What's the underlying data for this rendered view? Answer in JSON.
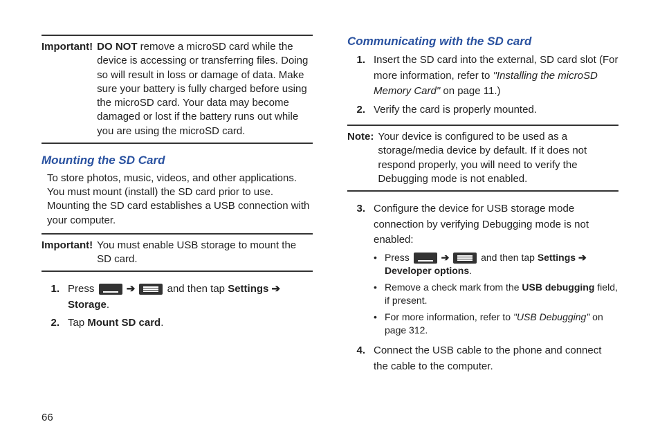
{
  "page_number": "66",
  "left": {
    "important1_label": "Important!",
    "important1_donot": "DO NOT",
    "important1_text": " remove a microSD card while the device is accessing or transferring files. Doing so will result in loss or damage of data. Make sure your battery is fully charged before using the microSD card. Your data may become damaged or lost if the battery runs out while you are using the microSD card.",
    "heading1": "Mounting the SD Card",
    "para1": "To store photos, music, videos, and other applications. You must mount (install) the SD card prior to use. Mounting the SD card establishes a USB connection with your computer.",
    "important2_label": "Important!",
    "important2_text": "You must enable USB storage to mount the SD card.",
    "step1_pre": "Press ",
    "step1_mid": " and then tap ",
    "step1_bold1": "Settings ",
    "step1_arrow": "➔",
    "step1_bold2": " Storage",
    "step2_pre": "Tap ",
    "step2_bold": "Mount SD card",
    "period": "."
  },
  "right": {
    "heading2": "Communicating with the SD card",
    "r1_text": "Insert the SD card into the external, SD card slot (For more information, refer to ",
    "r1_italic": "\"Installing the microSD Memory Card\"",
    "r1_after": "  on page 11.)",
    "r2_text": "Verify the card is properly mounted.",
    "note_label": "Note:",
    "note_text": "Your device is configured to be used as a storage/media device by default. If it does not respond properly, you will need to verify the Debugging mode is not enabled.",
    "r3_text": "Configure the device for USB storage mode connection by verifying Debugging mode is not enabled:",
    "b1_pre": "Press ",
    "b1_mid": " and then tap ",
    "b1_bold1": "Settings ",
    "b1_arrow": "➔",
    "b1_bold2": " Developer options",
    "b2_pre": "Remove a check mark from the ",
    "b2_bold": "USB debugging",
    "b2_post": " field, if present.",
    "b3_pre": "For more information, refer to ",
    "b3_italic": "\"USB Debugging\"",
    "b3_post": "  on page 312.",
    "r4_text": "Connect the USB cable to the phone and connect the cable to the computer."
  },
  "arrow": "➔"
}
